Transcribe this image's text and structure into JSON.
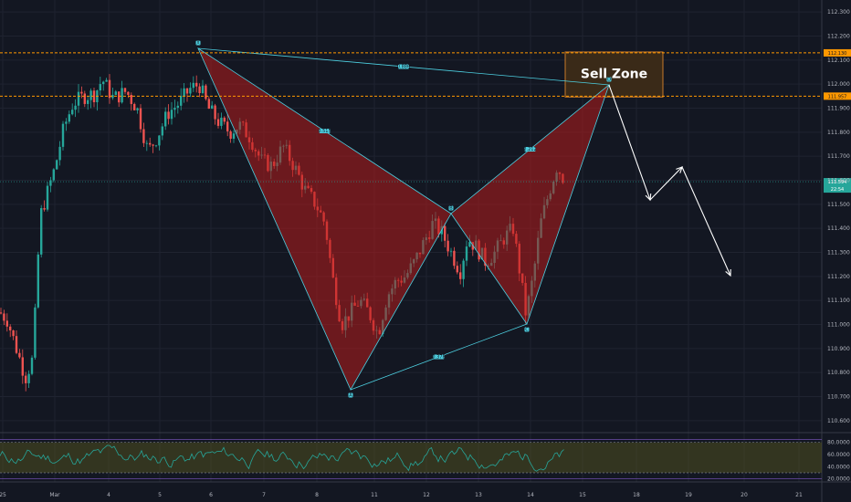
{
  "chart_data": {
    "type": "candlestick",
    "title": "",
    "xlabel": "",
    "ylabel": "",
    "x_ticks": [
      "25",
      "Mar",
      "4",
      "5",
      "6",
      "7",
      "8",
      "11",
      "12",
      "13",
      "14",
      "15",
      "18",
      "19",
      "20",
      "21"
    ],
    "ylim": [
      110.55,
      112.35
    ],
    "y_ticks": [
      "112.300",
      "112.200",
      "112.100",
      "112.000",
      "111.900",
      "111.800",
      "111.700",
      "111.600",
      "111.500",
      "111.400",
      "111.300",
      "111.200",
      "111.100",
      "111.000",
      "110.900",
      "110.800",
      "110.700",
      "110.600"
    ],
    "price_levels": [
      {
        "name": "upper",
        "value": 112.13,
        "label": "112.130"
      },
      {
        "name": "lower",
        "value": 111.95,
        "label": "111.957"
      }
    ],
    "current_price": {
      "value": 111.594,
      "label": "111.594",
      "timer": "22:54"
    },
    "pattern": {
      "points": [
        {
          "name": "X",
          "day": 5.8,
          "price": 112.14
        },
        {
          "name": "A",
          "day": 10.55,
          "price": 110.76
        },
        {
          "name": "B",
          "day": 12.55,
          "price": 111.47
        },
        {
          "name": "C",
          "day": 13.95,
          "price": 111.03
        },
        {
          "name": "D",
          "day": 15.45,
          "price": 112.0
        }
      ],
      "ratios": [
        {
          "from": "X",
          "to": "D",
          "label": "0.886"
        },
        {
          "from": "X",
          "to": "B",
          "label": "0.515"
        },
        {
          "from": "A",
          "to": "C",
          "label": "0.378"
        },
        {
          "from": "B",
          "to": "D",
          "label": "2.212"
        }
      ]
    },
    "projection": [
      {
        "day": 15.45,
        "price": 112.0
      },
      {
        "day": 16.3,
        "price": 111.5
      },
      {
        "day": 16.95,
        "price": 111.67
      },
      {
        "day": 17.8,
        "price": 111.2
      }
    ],
    "sell_zone": {
      "label": "Sell Zone",
      "day_start": 15.0,
      "day_end": 16.7,
      "price_top": 112.13,
      "price_bottom": 111.95
    },
    "oscillator": {
      "ylim": [
        15,
        90
      ],
      "y_ticks": [
        "80.0000",
        "60.0000",
        "40.0000",
        "20.0000"
      ],
      "band": [
        30,
        80
      ]
    }
  },
  "colors": {
    "background": "#131722",
    "grid": "#1f2330",
    "bull": "#26a69a",
    "bear": "#ef5350",
    "level": "#ff9800",
    "pattern_fill": "#b71c1c",
    "pattern_line": "#4dd0e1",
    "oscillator": "#26a69a",
    "band_fill": "#5a5a1e",
    "sell_zone_fill": "#3a2a18",
    "sell_zone_border": "#c77a2a"
  }
}
